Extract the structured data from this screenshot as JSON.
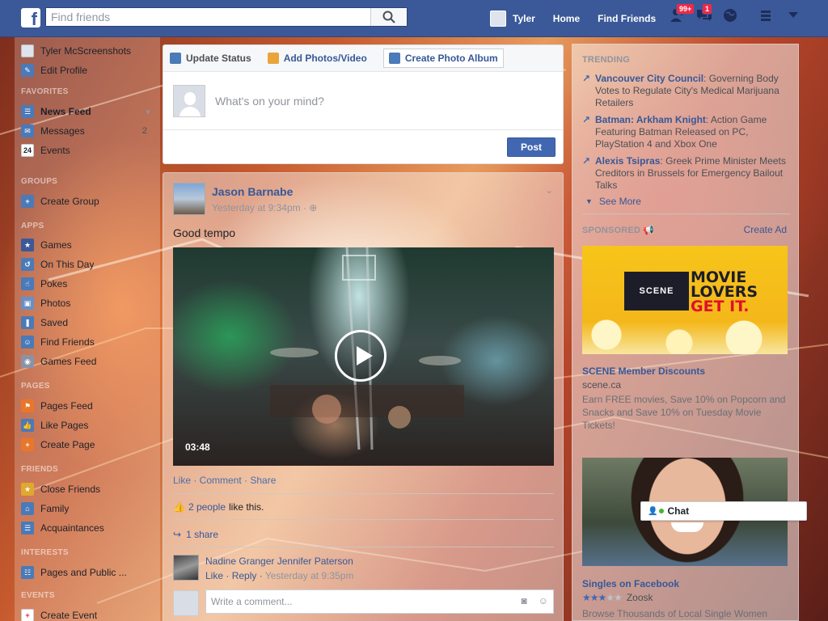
{
  "topbar": {
    "logo": "f",
    "search_placeholder": "Find friends",
    "user_name": "Tyler",
    "home": "Home",
    "find_friends": "Find Friends",
    "friend_requests_badge": "99+",
    "messages_badge": "1"
  },
  "left_nav": {
    "profile_name": "Tyler McScreenshots",
    "edit_profile": "Edit Profile",
    "favorites_header": "FAVORITES",
    "favorites": [
      {
        "label": "News Feed",
        "icon": "news-feed-icon"
      },
      {
        "label": "Messages",
        "count": "2",
        "icon": "messages-icon"
      },
      {
        "label": "Events",
        "icon": "calendar-icon",
        "icon_text": "24"
      }
    ],
    "groups_header": "GROUPS",
    "groups": [
      {
        "label": "Create Group",
        "icon": "create-group-icon"
      }
    ],
    "apps_header": "APPS",
    "apps": [
      {
        "label": "Games",
        "icon": "games-icon"
      },
      {
        "label": "On This Day",
        "icon": "on-this-day-icon"
      },
      {
        "label": "Pokes",
        "icon": "pokes-icon"
      },
      {
        "label": "Photos",
        "icon": "photos-icon"
      },
      {
        "label": "Saved",
        "icon": "saved-icon"
      },
      {
        "label": "Find Friends",
        "icon": "find-friends-icon"
      },
      {
        "label": "Games Feed",
        "icon": "games-feed-icon"
      }
    ],
    "pages_header": "PAGES",
    "pages": [
      {
        "label": "Pages Feed",
        "icon": "pages-feed-icon"
      },
      {
        "label": "Like Pages",
        "icon": "like-pages-icon"
      },
      {
        "label": "Create Page",
        "icon": "create-page-icon"
      }
    ],
    "friends_header": "FRIENDS",
    "friends": [
      {
        "label": "Close Friends",
        "icon": "close-friends-icon"
      },
      {
        "label": "Family",
        "icon": "family-icon"
      },
      {
        "label": "Acquaintances",
        "icon": "acquaintances-icon"
      }
    ],
    "interests_header": "INTERESTS",
    "interests": [
      {
        "label": "Pages and Public ...",
        "icon": "pages-public-icon"
      }
    ],
    "events_header": "EVENTS",
    "events": [
      {
        "label": "Create Event",
        "icon": "create-event-icon"
      }
    ]
  },
  "composer": {
    "tab_status": "Update Status",
    "tab_photos": "Add Photos/Video",
    "tab_album": "Create Photo Album",
    "placeholder": "What's on your mind?",
    "post_button": "Post"
  },
  "post": {
    "author": "Jason Barnabe",
    "time": "Yesterday at 9:34pm · ",
    "text": "Good tempo",
    "video_duration": "03:48",
    "actions": "Like · Comment · Share",
    "likes_count": "2 people",
    "likes_suffix": "like this.",
    "shares": "1 share",
    "comment": {
      "names": "Nadine Granger Jennifer Paterson",
      "like": "Like",
      "reply": "Reply",
      "time": "Yesterday at 9:35pm"
    },
    "comment_placeholder": "Write a comment..."
  },
  "right_col": {
    "trending_header": "TRENDING",
    "trending": [
      {
        "title": "Vancouver City Council",
        "desc": ": Governing Body Votes to Regulate City's Medical Marijuana Retailers"
      },
      {
        "title": "Batman: Arkham Knight",
        "desc": ": Action Game Featuring Batman Released on PC, PlayStation 4 and Xbox One"
      },
      {
        "title": "Alexis Tsipras",
        "desc": ": Greek Prime Minister Meets Creditors in Brussels for Emergency Bailout Talks"
      }
    ],
    "see_more": "See More",
    "sponsored_header": "SPONSORED",
    "create_ad": "Create Ad",
    "ad1": {
      "brand": "SCENE",
      "line1": "MOVIE",
      "line2": "LOVERS",
      "line3": "GET IT.",
      "title": "SCENE Member Discounts",
      "url": "scene.ca",
      "desc": "Earn FREE movies, Save 10% on Popcorn and Snacks and Save 10% on Tuesday Movie Tickets!"
    },
    "ad2": {
      "title": "Singles on Facebook",
      "rating": 3,
      "rating_max": 5,
      "brand": "Zoosk",
      "desc": "Browse Thousands of Local Single Women"
    }
  },
  "chat": {
    "label": "Chat"
  }
}
